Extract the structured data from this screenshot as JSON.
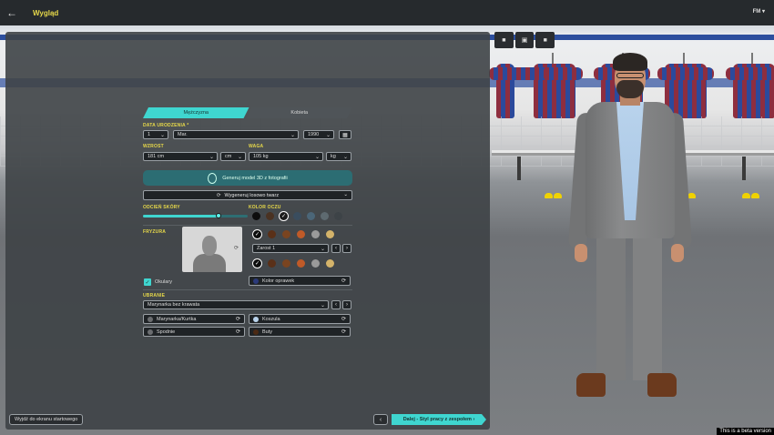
{
  "topbar": {
    "title": "Wygląd",
    "menu_label": "FM",
    "menu_chevron": "▾",
    "back_icon": "←"
  },
  "gender_tabs": [
    {
      "label": "Mężczyzna",
      "active": true
    },
    {
      "label": "Kobieta",
      "active": false
    }
  ],
  "birth_date": {
    "label": "DATA URODZENIA",
    "required_mark": "*",
    "day": "1",
    "month": "Mar.",
    "year": "1990",
    "calendar_icon": "▦"
  },
  "height": {
    "label": "WZROST",
    "value": "181 cm",
    "unit": "cm"
  },
  "weight": {
    "label": "WAGA",
    "value": "105 kg",
    "unit": "kg"
  },
  "generate_photo_label": "Generuj model 3D z fotografii",
  "generate_face_label": "Wygeneruj losowo twarz",
  "skin": {
    "label": "ODCIEŃ SKÓRY",
    "level": 0.72
  },
  "eyes": {
    "label": "KOLOR OCZU",
    "colors": [
      "#0d0d0d",
      "#4a3222",
      "#1c1c1c",
      "#3a4d5e",
      "#4b6678",
      "#5e6a70",
      "#3d4347"
    ],
    "selected_index": 2
  },
  "hair": {
    "label": "FRYZURA",
    "colors_row1": [
      "#0d0d0d",
      "#5a3018",
      "#7a4420",
      "#c05a28",
      "#9a9a9a",
      "#d4b36a"
    ],
    "selected_row1": 0,
    "beard_value": "Zarost 1",
    "colors_row2": [
      "#0d0d0d",
      "#5a3018",
      "#7a4420",
      "#c05a28",
      "#9a9a9a",
      "#d4b36a"
    ],
    "selected_row2": 0,
    "rotate_icon": "⟳"
  },
  "glasses": {
    "label": "Okulary",
    "checked": true,
    "frame_color_label": "Kolor oprawek",
    "frame_color": "#2b3a7a"
  },
  "clothing": {
    "label": "UBRANIE",
    "outfit_value": "Marynarka bez krawata",
    "jacket_label": "Marynarka/Kurtka",
    "shirt_label": "Koszula",
    "trousers_label": "Spodnie",
    "shoes_label": "Buty",
    "jacket_color": "#6b6d70",
    "shirt_color": "#b9d3ec",
    "trousers_color": "#6b6d70",
    "shoes_color": "#4b2a14"
  },
  "camera": {
    "icons": [
      "■",
      "▣",
      "■"
    ]
  },
  "footer": {
    "exit_label": "Wyjdź do ekranu startowego",
    "prev_icon": "‹",
    "next_label": "Dalej - Styl pracy z zespołem",
    "next_icon": "›"
  },
  "beta_notice": "This is a beta version",
  "colors": {
    "accent": "#3fd6d0",
    "title_yellow": "#e6d84a"
  }
}
